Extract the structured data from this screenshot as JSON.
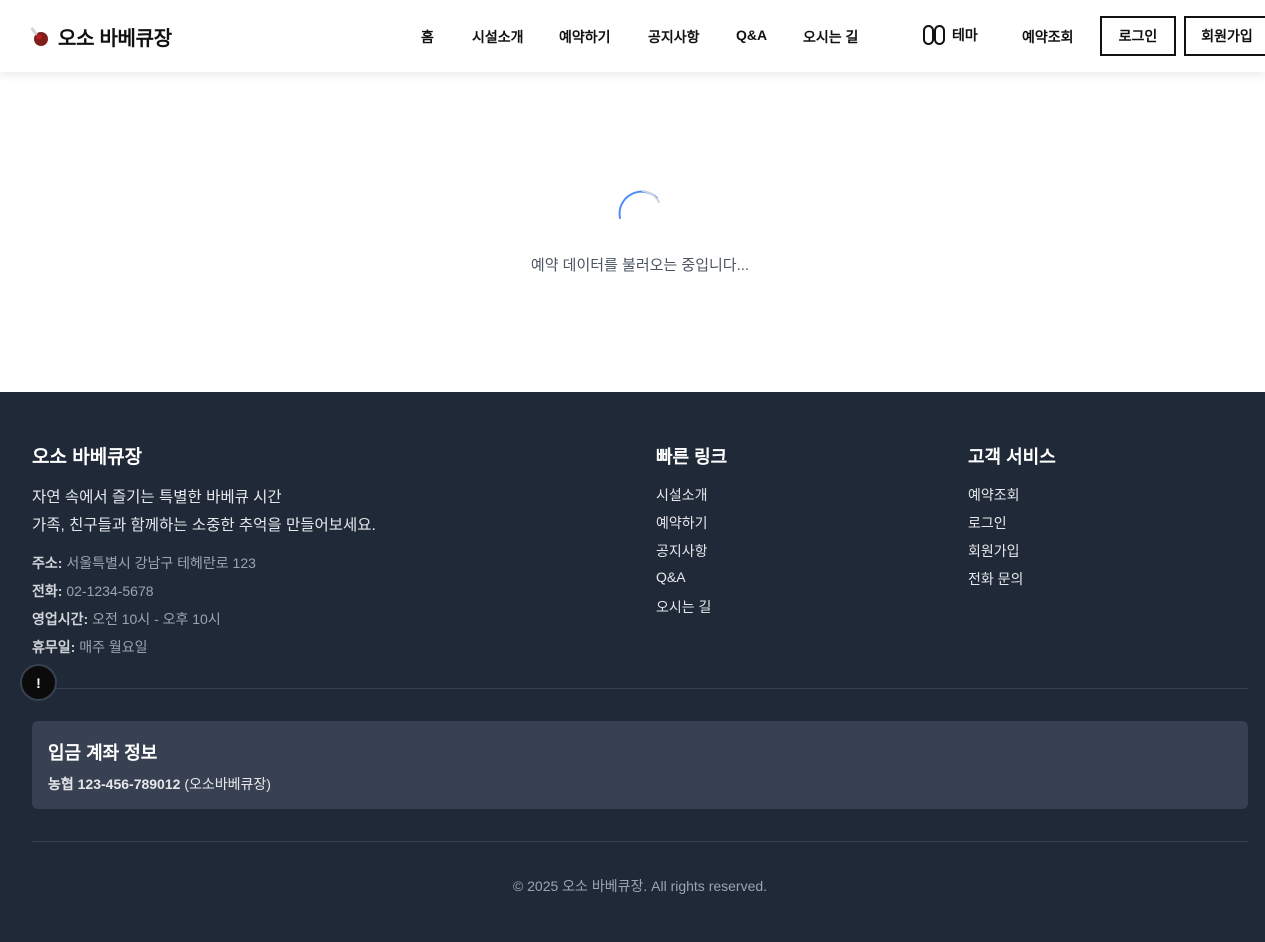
{
  "header": {
    "brand": "오소 바베큐장",
    "nav": [
      "홈",
      "시설소개",
      "예약하기",
      "공지사항",
      "Q&A",
      "오시는 길"
    ],
    "theme_label": "테마",
    "reservation_lookup": "예약조회",
    "login": "로그인",
    "signup": "회원가입"
  },
  "main": {
    "loading_text": "예약 데이터를 불러오는 중입니다...",
    "spinner_color": "#3b82f6"
  },
  "footer": {
    "brand_title": "오소 바베큐장",
    "desc_line1": "자연 속에서 즐기는 특별한 바베큐 시간",
    "desc_line2": "가족, 친구들과 함께하는 소중한 추억을 만들어보세요.",
    "info": [
      {
        "label": "주소:",
        "value": "서울특별시 강남구 테헤란로 123"
      },
      {
        "label": "전화:",
        "value": "02-1234-5678"
      },
      {
        "label": "영업시간:",
        "value": "오전 10시 - 오후 10시"
      },
      {
        "label": "휴무일:",
        "value": "매주 월요일"
      }
    ],
    "quick_links_title": "빠른 링크",
    "quick_links": [
      "시설소개",
      "예약하기",
      "공지사항",
      "Q&A",
      "오시는 길"
    ],
    "service_title": "고객 서비스",
    "service_links": [
      "예약조회",
      "로그인",
      "회원가입",
      "전화 문의"
    ],
    "account_title": "입금 계좌 정보",
    "account_number": "농협 123-456-789012",
    "account_holder": "(오소바베큐장)",
    "copyright": "© 2025 오소 바베큐장. All rights reserved.",
    "background_color": "#1f2937"
  },
  "alert_button": "!"
}
